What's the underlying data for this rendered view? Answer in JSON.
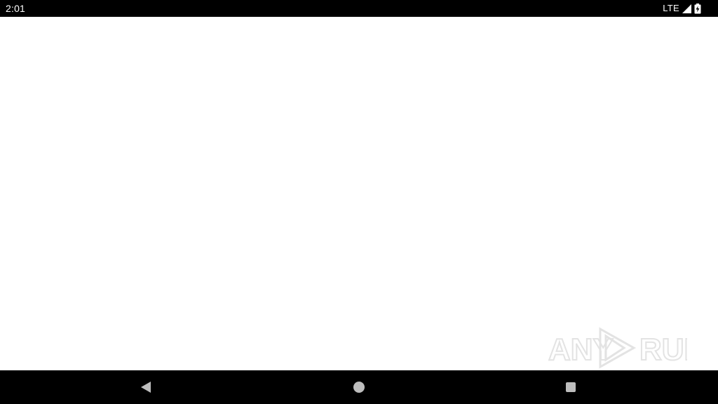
{
  "status_bar": {
    "time": "2:01",
    "network": "LTE",
    "icons": [
      "signal-icon",
      "battery-icon"
    ]
  },
  "watermark": {
    "text_left": "ANY",
    "text_right": "RUN"
  },
  "nav_bar": {
    "buttons": [
      "back-icon",
      "home-icon",
      "recents-icon"
    ]
  },
  "colors": {
    "bars": "#000000",
    "background": "#ffffff",
    "nav_icons": "#bdbdbd",
    "watermark": "#e6e6e6"
  }
}
